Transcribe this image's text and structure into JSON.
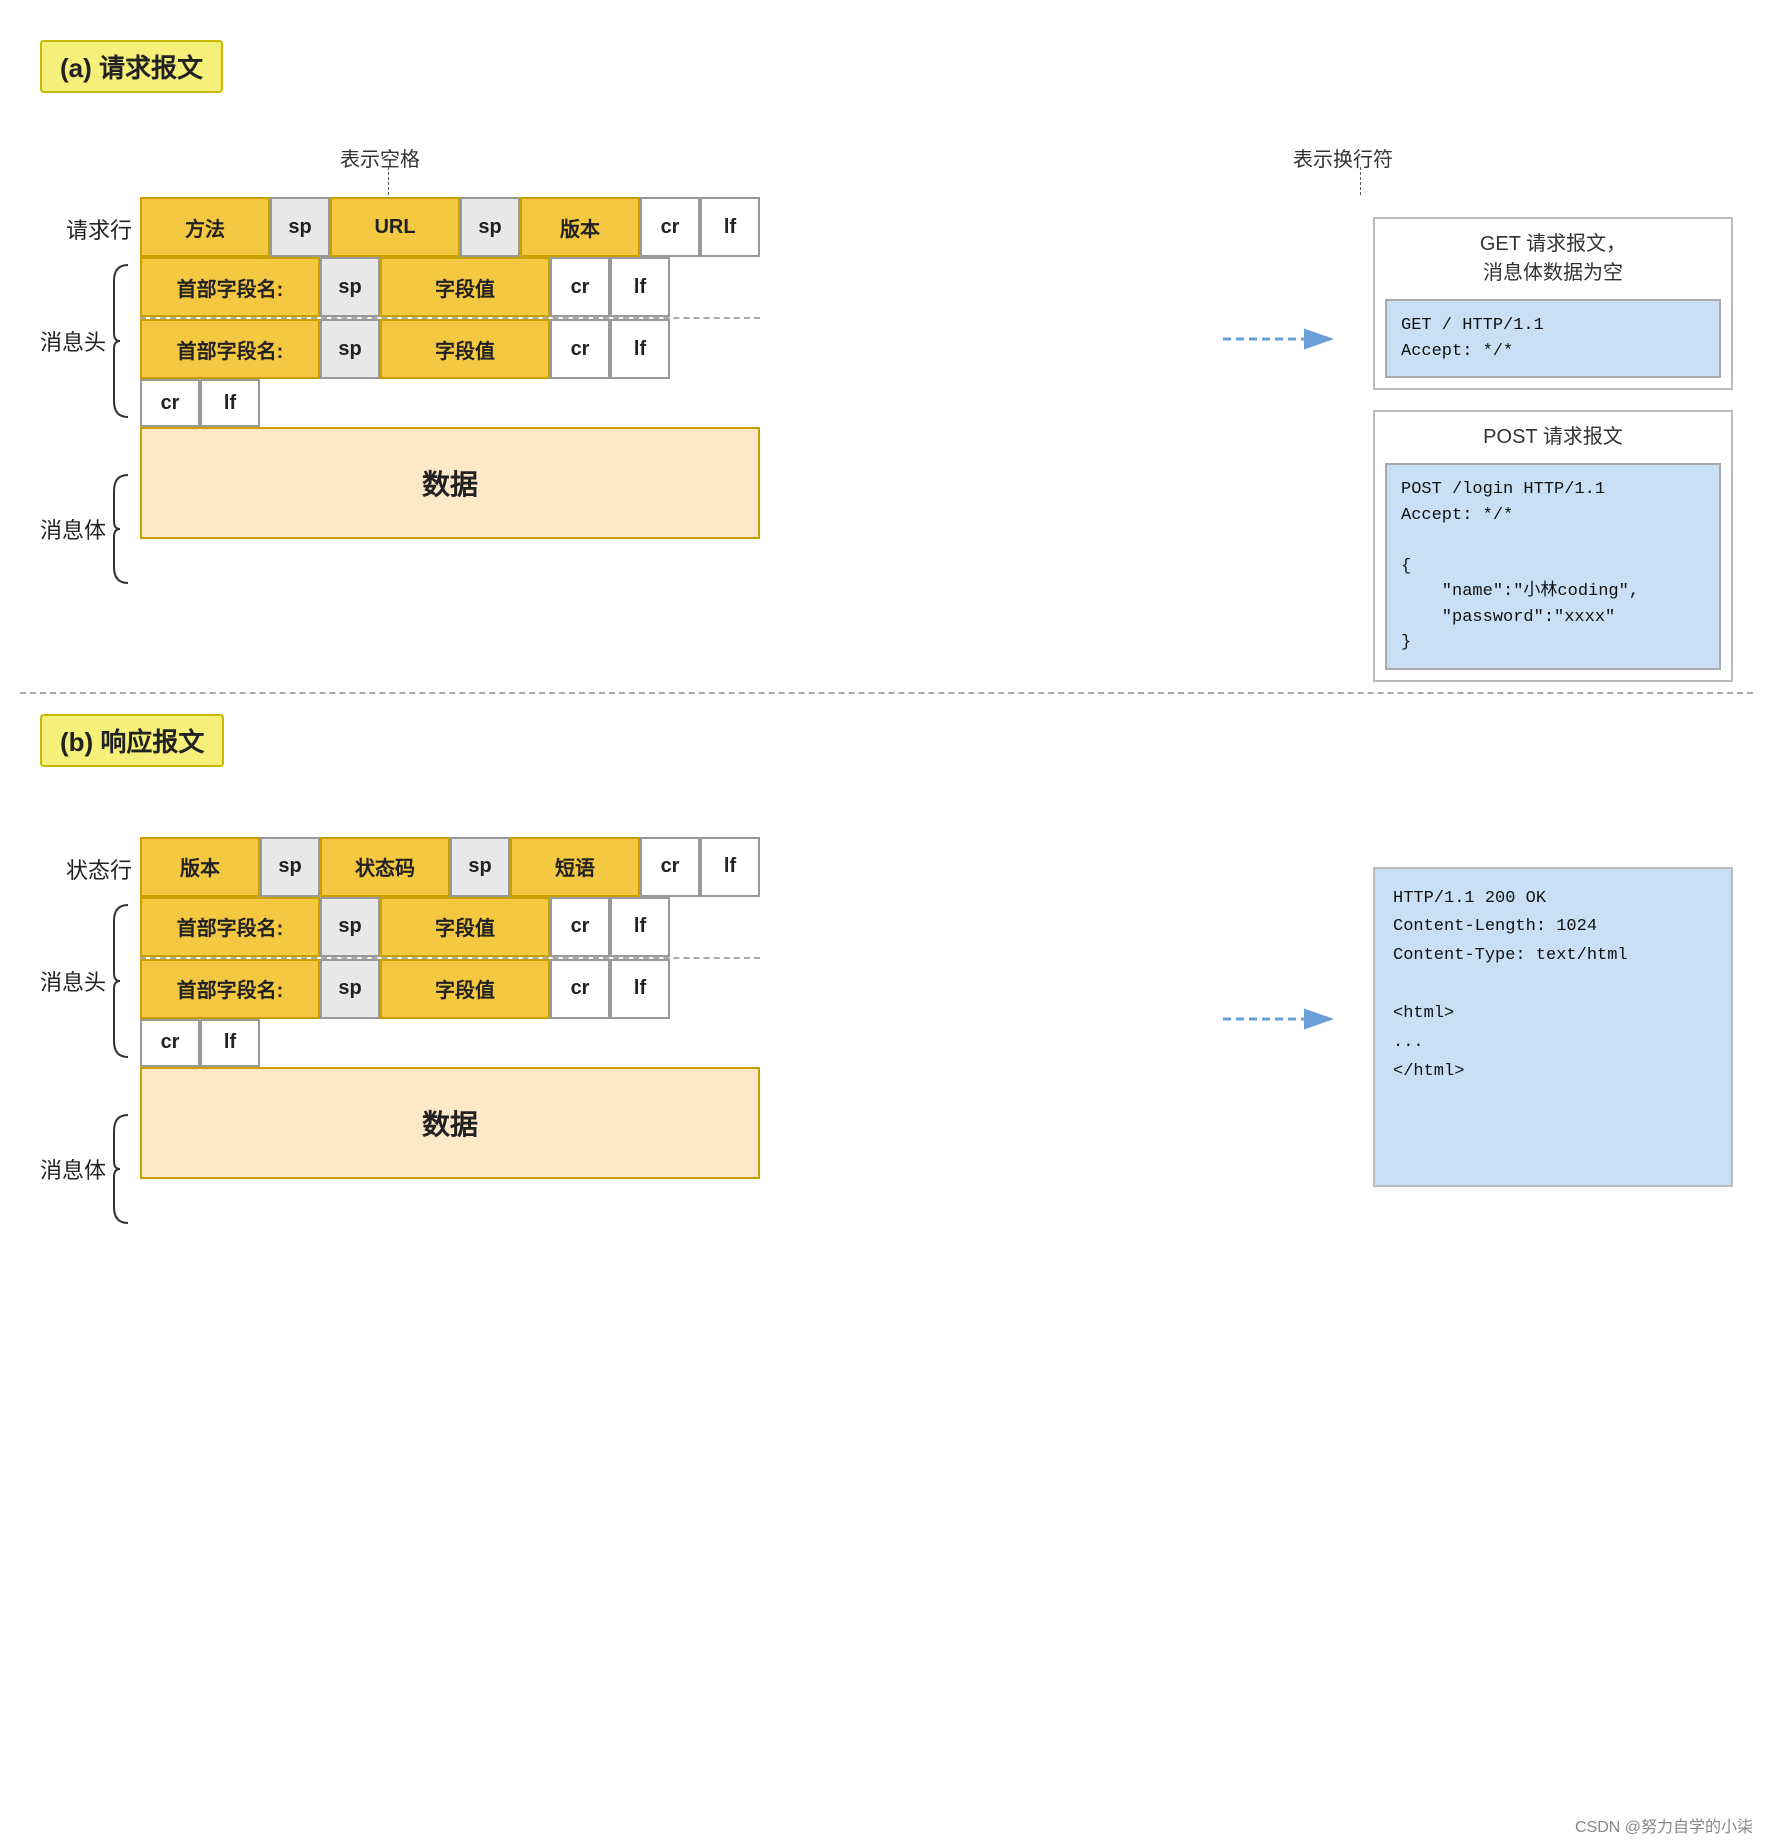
{
  "section_a": {
    "label": "(a) 请求报文",
    "annotations": {
      "left_label": "表示空格",
      "right_label": "表示换行符"
    },
    "request_row_label": "请求行",
    "header_label": "消息头",
    "body_label": "消息体",
    "request_row": [
      "方法",
      "sp",
      "URL",
      "sp",
      "版本",
      "cr",
      "lf"
    ],
    "header_row1": [
      "首部字段名:",
      "sp",
      "字段值",
      "cr",
      "lf"
    ],
    "header_row2": [
      "首部字段名:",
      "sp",
      "字段值",
      "cr",
      "lf"
    ],
    "cr_lf_row": [
      "cr",
      "lf"
    ],
    "data_label": "数据",
    "examples": {
      "get_title": "GET 请求报文，\n消息体数据为空",
      "get_code": "GET / HTTP/1.1\nAccept: */*",
      "post_title": "POST 请求报文",
      "post_code": "POST /login HTTP/1.1\nAccept: */*\n\n{\n    \"name\":\"小林coding\",\n    \"password\":\"xxxx\"\n}"
    }
  },
  "section_b": {
    "label": "(b) 响应报文",
    "status_row_label": "状态行",
    "header_label": "消息头",
    "body_label": "消息体",
    "status_row": [
      "版本",
      "sp",
      "状态码",
      "sp",
      "短语",
      "cr",
      "lf"
    ],
    "header_row1": [
      "首部字段名:",
      "sp",
      "字段值",
      "cr",
      "lf"
    ],
    "header_row2": [
      "首部字段名:",
      "sp",
      "字段值",
      "cr",
      "lf"
    ],
    "cr_lf_row": [
      "cr",
      "lf"
    ],
    "data_label": "数据",
    "example_code": "HTTP/1.1 200 OK\nContent-Length: 1024\nContent-Type: text/html\n\n<html>\n...\n</html>"
  },
  "watermark": "CSDN @努力自学的小柒"
}
